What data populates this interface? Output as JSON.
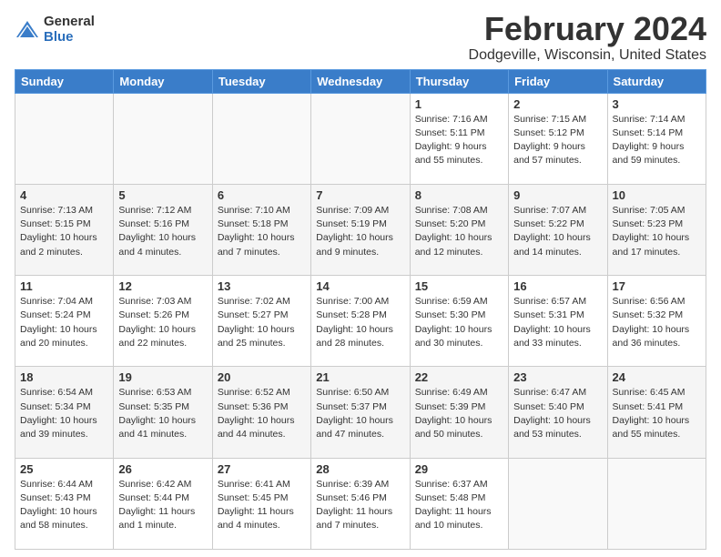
{
  "header": {
    "logo": {
      "general": "General",
      "blue": "Blue"
    },
    "month_year": "February 2024",
    "location": "Dodgeville, Wisconsin, United States"
  },
  "days_of_week": [
    "Sunday",
    "Monday",
    "Tuesday",
    "Wednesday",
    "Thursday",
    "Friday",
    "Saturday"
  ],
  "weeks": [
    [
      {
        "day": "",
        "info": ""
      },
      {
        "day": "",
        "info": ""
      },
      {
        "day": "",
        "info": ""
      },
      {
        "day": "",
        "info": ""
      },
      {
        "day": "1",
        "info": "Sunrise: 7:16 AM\nSunset: 5:11 PM\nDaylight: 9 hours\nand 55 minutes."
      },
      {
        "day": "2",
        "info": "Sunrise: 7:15 AM\nSunset: 5:12 PM\nDaylight: 9 hours\nand 57 minutes."
      },
      {
        "day": "3",
        "info": "Sunrise: 7:14 AM\nSunset: 5:14 PM\nDaylight: 9 hours\nand 59 minutes."
      }
    ],
    [
      {
        "day": "4",
        "info": "Sunrise: 7:13 AM\nSunset: 5:15 PM\nDaylight: 10 hours\nand 2 minutes."
      },
      {
        "day": "5",
        "info": "Sunrise: 7:12 AM\nSunset: 5:16 PM\nDaylight: 10 hours\nand 4 minutes."
      },
      {
        "day": "6",
        "info": "Sunrise: 7:10 AM\nSunset: 5:18 PM\nDaylight: 10 hours\nand 7 minutes."
      },
      {
        "day": "7",
        "info": "Sunrise: 7:09 AM\nSunset: 5:19 PM\nDaylight: 10 hours\nand 9 minutes."
      },
      {
        "day": "8",
        "info": "Sunrise: 7:08 AM\nSunset: 5:20 PM\nDaylight: 10 hours\nand 12 minutes."
      },
      {
        "day": "9",
        "info": "Sunrise: 7:07 AM\nSunset: 5:22 PM\nDaylight: 10 hours\nand 14 minutes."
      },
      {
        "day": "10",
        "info": "Sunrise: 7:05 AM\nSunset: 5:23 PM\nDaylight: 10 hours\nand 17 minutes."
      }
    ],
    [
      {
        "day": "11",
        "info": "Sunrise: 7:04 AM\nSunset: 5:24 PM\nDaylight: 10 hours\nand 20 minutes."
      },
      {
        "day": "12",
        "info": "Sunrise: 7:03 AM\nSunset: 5:26 PM\nDaylight: 10 hours\nand 22 minutes."
      },
      {
        "day": "13",
        "info": "Sunrise: 7:02 AM\nSunset: 5:27 PM\nDaylight: 10 hours\nand 25 minutes."
      },
      {
        "day": "14",
        "info": "Sunrise: 7:00 AM\nSunset: 5:28 PM\nDaylight: 10 hours\nand 28 minutes."
      },
      {
        "day": "15",
        "info": "Sunrise: 6:59 AM\nSunset: 5:30 PM\nDaylight: 10 hours\nand 30 minutes."
      },
      {
        "day": "16",
        "info": "Sunrise: 6:57 AM\nSunset: 5:31 PM\nDaylight: 10 hours\nand 33 minutes."
      },
      {
        "day": "17",
        "info": "Sunrise: 6:56 AM\nSunset: 5:32 PM\nDaylight: 10 hours\nand 36 minutes."
      }
    ],
    [
      {
        "day": "18",
        "info": "Sunrise: 6:54 AM\nSunset: 5:34 PM\nDaylight: 10 hours\nand 39 minutes."
      },
      {
        "day": "19",
        "info": "Sunrise: 6:53 AM\nSunset: 5:35 PM\nDaylight: 10 hours\nand 41 minutes."
      },
      {
        "day": "20",
        "info": "Sunrise: 6:52 AM\nSunset: 5:36 PM\nDaylight: 10 hours\nand 44 minutes."
      },
      {
        "day": "21",
        "info": "Sunrise: 6:50 AM\nSunset: 5:37 PM\nDaylight: 10 hours\nand 47 minutes."
      },
      {
        "day": "22",
        "info": "Sunrise: 6:49 AM\nSunset: 5:39 PM\nDaylight: 10 hours\nand 50 minutes."
      },
      {
        "day": "23",
        "info": "Sunrise: 6:47 AM\nSunset: 5:40 PM\nDaylight: 10 hours\nand 53 minutes."
      },
      {
        "day": "24",
        "info": "Sunrise: 6:45 AM\nSunset: 5:41 PM\nDaylight: 10 hours\nand 55 minutes."
      }
    ],
    [
      {
        "day": "25",
        "info": "Sunrise: 6:44 AM\nSunset: 5:43 PM\nDaylight: 10 hours\nand 58 minutes."
      },
      {
        "day": "26",
        "info": "Sunrise: 6:42 AM\nSunset: 5:44 PM\nDaylight: 11 hours\nand 1 minute."
      },
      {
        "day": "27",
        "info": "Sunrise: 6:41 AM\nSunset: 5:45 PM\nDaylight: 11 hours\nand 4 minutes."
      },
      {
        "day": "28",
        "info": "Sunrise: 6:39 AM\nSunset: 5:46 PM\nDaylight: 11 hours\nand 7 minutes."
      },
      {
        "day": "29",
        "info": "Sunrise: 6:37 AM\nSunset: 5:48 PM\nDaylight: 11 hours\nand 10 minutes."
      },
      {
        "day": "",
        "info": ""
      },
      {
        "day": "",
        "info": ""
      }
    ]
  ]
}
